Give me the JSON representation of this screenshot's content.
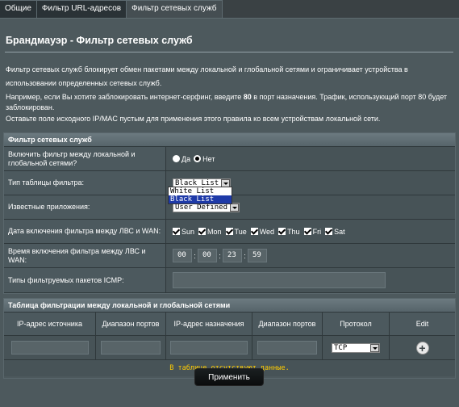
{
  "tabs": [
    {
      "label": "Общие"
    },
    {
      "label": "Фильтр URL-адресов"
    },
    {
      "label": "Фильтр сетевых служб"
    }
  ],
  "title": "Брандмауэр - Фильтр сетевых служб",
  "description": {
    "line1": "Фильтр сетевых служб блокирует обмен пакетами между локальной и глобальной сетями и ограничивает устройства в",
    "line2": "использовании определенных сетевых служб.",
    "line3_pre": "Например, если Вы хотите заблокировать интернет-серфинг, введите ",
    "line3_bold": "80",
    "line3_post": " в порт назначения. Трафик, использующий порт 80 будет",
    "line4": "заблокирован.",
    "line5": "Оставьте поле исходного IP/MAC пустым для применения этого правила ко всем устройствам локальной сети."
  },
  "filter_section": {
    "header": "Фильтр сетевых служб",
    "enable_label": "Включить фильтр между локальной и глобальной сетями?",
    "enable_yes": "Да",
    "enable_no": "Нет",
    "table_type_label": "Тип таблицы фильтра:",
    "table_type_value": "Black List",
    "table_type_options": [
      "White List",
      "Black List"
    ],
    "known_apps_label": "Известные приложения:",
    "known_apps_value": "User Defined",
    "days_label": "Дата включения фильтра между ЛВС и WAN:",
    "days": [
      "Sun",
      "Mon",
      "Tue",
      "Wed",
      "Thu",
      "Fri",
      "Sat"
    ],
    "time_label": "Время включения фильтра между ЛВС и WAN:",
    "time_values": [
      "00",
      "00",
      "23",
      "59"
    ],
    "time_sep": ":",
    "icmp_label": "Типы фильтруемых пакетов ICMP:",
    "icmp_value": ""
  },
  "table_section": {
    "header": "Таблица фильтрации между локальной и глобальной сетями",
    "columns": [
      "IP-адрес источника",
      "Диапазон портов",
      "IP-адрес назначения",
      "Диапазон портов",
      "Протокол",
      "Edit"
    ],
    "protocol_value": "TCP",
    "empty_text": "В таблице отсутствуют данные."
  },
  "apply_label": "Применить"
}
